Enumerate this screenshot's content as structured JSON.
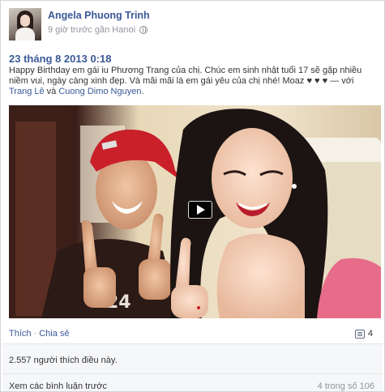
{
  "author": {
    "name": "Angela Phuong Trinh",
    "meta": "9 giờ trước gần Hanoi",
    "privacy_icon": "globe-icon"
  },
  "post": {
    "timestamp": "23 tháng 8 2013 0:18",
    "caption_text": "Happy Birthday em gái iu Phương Trang của chị. Chúc em sinh nhật tuổi 17 sẽ gặp nhiều niềm vui, ngày càng xinh đẹp. Và mãi mãi là em gái yêu của chị nhé! Moaz ♥ ♥ ♥ — với ",
    "tag_1": "Trang Lê",
    "tag_joiner": " và ",
    "tag_2": "Cuong Dimo Nguyen",
    "tag_end": "."
  },
  "video": {
    "play_icon": "play-icon"
  },
  "actions": {
    "like": "Thích",
    "separator": "·",
    "share": "Chia sẻ",
    "comment_count": "4"
  },
  "ufi": {
    "likes": "2.557 người thích điều này.",
    "view_more": "Xem các bình luận trước",
    "pager": "4 trong số 106"
  }
}
